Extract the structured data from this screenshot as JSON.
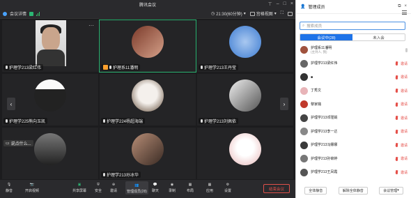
{
  "window": {
    "title": "腾讯会议"
  },
  "info": {
    "meeting_info_label": "会议详情",
    "time": "21:30(60分钟)",
    "view_label": "宫格视图"
  },
  "tiles": [
    {
      "name": "护理学213梁红伟",
      "type": "camera"
    },
    {
      "name": "护理系11潘明",
      "type": "avatar",
      "host": true,
      "active": true,
      "color": "#a0523d"
    },
    {
      "name": "护理学213王丹莹",
      "type": "avatar",
      "color": "#3c7bd1"
    },
    {
      "name": "护理学225熊向玉凯",
      "type": "avatar",
      "color": "#3a3a3a"
    },
    {
      "name": "护理学224杨超海端",
      "type": "avatar",
      "color": "#d8d0c8"
    },
    {
      "name": "护理学213刘佩依",
      "type": "avatar",
      "color": "#777777"
    },
    {
      "name": "说点什么...",
      "type": "avatar",
      "color": "#555555",
      "chat_hint": true
    },
    {
      "name": "护理学213孙冰华",
      "type": "avatar",
      "color": "#7a5a4a"
    },
    {
      "name": "",
      "type": "avatar",
      "color": "#f1e1e1"
    }
  ],
  "toolbar": {
    "mute": "静音",
    "video": "开启视频",
    "share": "共享屏幕",
    "security": "安全",
    "invite": "邀请",
    "members": "管理成员(28)",
    "chat": "聊天",
    "record": "录制",
    "apps": "应用",
    "settings": "设置",
    "leave": "结束会议",
    "layout": "布局"
  },
  "panel": {
    "title": "管理成员",
    "search_placeholder": "搜索成员",
    "tab_in": "会议中(28)",
    "tab_out": "未入会",
    "members": [
      {
        "name": "护理系11潘明",
        "sub": "(主持人, 我)",
        "color": "#a0523d",
        "muted": false,
        "action": ""
      },
      {
        "name": "护理学213梁红伟",
        "sub": "",
        "color": "#666",
        "muted": true,
        "action": "邀请"
      },
      {
        "name": "■",
        "sub": "",
        "color": "#333",
        "muted": true,
        "action": "邀请"
      },
      {
        "name": "丁秀文",
        "sub": "",
        "color": "#e8b4b8",
        "muted": true,
        "action": "邀请"
      },
      {
        "name": "黎家璐",
        "sub": "",
        "color": "#c0392b",
        "muted": true,
        "action": "邀请"
      },
      {
        "name": "护理学213邓瑾娟",
        "sub": "",
        "color": "#444",
        "muted": true,
        "action": "邀请"
      },
      {
        "name": "护理学213李一达",
        "sub": "",
        "color": "#888",
        "muted": true,
        "action": "邀请"
      },
      {
        "name": "护理学213冯娜娜",
        "sub": "",
        "color": "#3a3a3a",
        "muted": true,
        "action": "邀请"
      },
      {
        "name": "护理学213孙锦婷",
        "sub": "",
        "color": "#777",
        "muted": true,
        "action": "邀请"
      },
      {
        "name": "护理学213王凤霞",
        "sub": "",
        "color": "#555",
        "muted": true,
        "action": "邀请"
      },
      {
        "name": "护理学213黄家宇",
        "sub": "",
        "color": "#222",
        "muted": true,
        "action": "邀请"
      }
    ],
    "footer": {
      "mute_all": "全体静音",
      "unmute_all": "解除全体静音",
      "manage": "会议管理"
    }
  },
  "colors": {
    "accent": "#1e73e8",
    "active_border": "#2bb673",
    "danger": "#e5504a"
  }
}
